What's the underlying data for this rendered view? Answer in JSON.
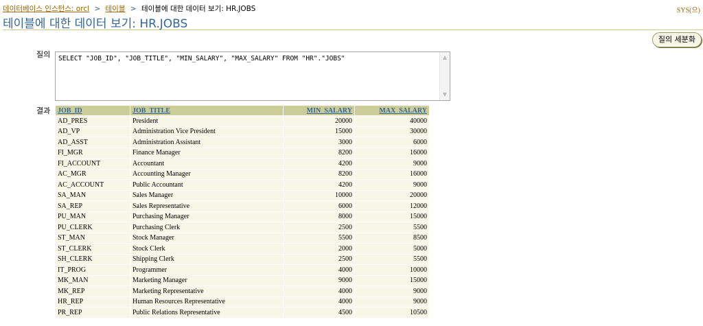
{
  "breadcrumb": {
    "instance_link": "데이터베이스 인스턴스: orcl",
    "table_link": "테이블",
    "separator": ">",
    "current": "테이블에 대한 데이터 보기: HR.JOBS"
  },
  "user_label": "SYS(으)",
  "page_title": "테이블에 대한 데이터 보기: HR.JOBS",
  "refine_query_button": "질의 세분화",
  "query": {
    "label": "질의",
    "text": "SELECT \"JOB_ID\", \"JOB_TITLE\", \"MIN_SALARY\", \"MAX_SALARY\" FROM \"HR\".\"JOBS\""
  },
  "result": {
    "label": "결과",
    "columns": [
      "JOB_ID",
      "JOB_TITLE",
      "MIN_SALARY",
      "MAX_SALARY"
    ],
    "rows": [
      [
        "AD_PRES",
        "President",
        "20000",
        "40000"
      ],
      [
        "AD_VP",
        "Administration Vice President",
        "15000",
        "30000"
      ],
      [
        "AD_ASST",
        "Administration Assistant",
        "3000",
        "6000"
      ],
      [
        "FI_MGR",
        "Finance Manager",
        "8200",
        "16000"
      ],
      [
        "FI_ACCOUNT",
        "Accountant",
        "4200",
        "9000"
      ],
      [
        "AC_MGR",
        "Accounting Manager",
        "8200",
        "16000"
      ],
      [
        "AC_ACCOUNT",
        "Public Accountant",
        "4200",
        "9000"
      ],
      [
        "SA_MAN",
        "Sales Manager",
        "10000",
        "20000"
      ],
      [
        "SA_REP",
        "Sales Representative",
        "6000",
        "12000"
      ],
      [
        "PU_MAN",
        "Purchasing Manager",
        "8000",
        "15000"
      ],
      [
        "PU_CLERK",
        "Purchasing Clerk",
        "2500",
        "5500"
      ],
      [
        "ST_MAN",
        "Stock Manager",
        "5500",
        "8500"
      ],
      [
        "ST_CLERK",
        "Stock Clerk",
        "2000",
        "5000"
      ],
      [
        "SH_CLERK",
        "Shipping Clerk",
        "2500",
        "5500"
      ],
      [
        "IT_PROG",
        "Programmer",
        "4000",
        "10000"
      ],
      [
        "MK_MAN",
        "Marketing Manager",
        "9000",
        "15000"
      ],
      [
        "MK_REP",
        "Marketing Representative",
        "4000",
        "9000"
      ],
      [
        "HR_REP",
        "Human Resources Representative",
        "4000",
        "9000"
      ],
      [
        "PR_REP",
        "Public Relations Representative",
        "4500",
        "10500"
      ]
    ]
  },
  "colors": {
    "link": "#996600",
    "title": "#336699",
    "header_bg": "#cccc99",
    "row_bg": "#f7f7e7"
  }
}
